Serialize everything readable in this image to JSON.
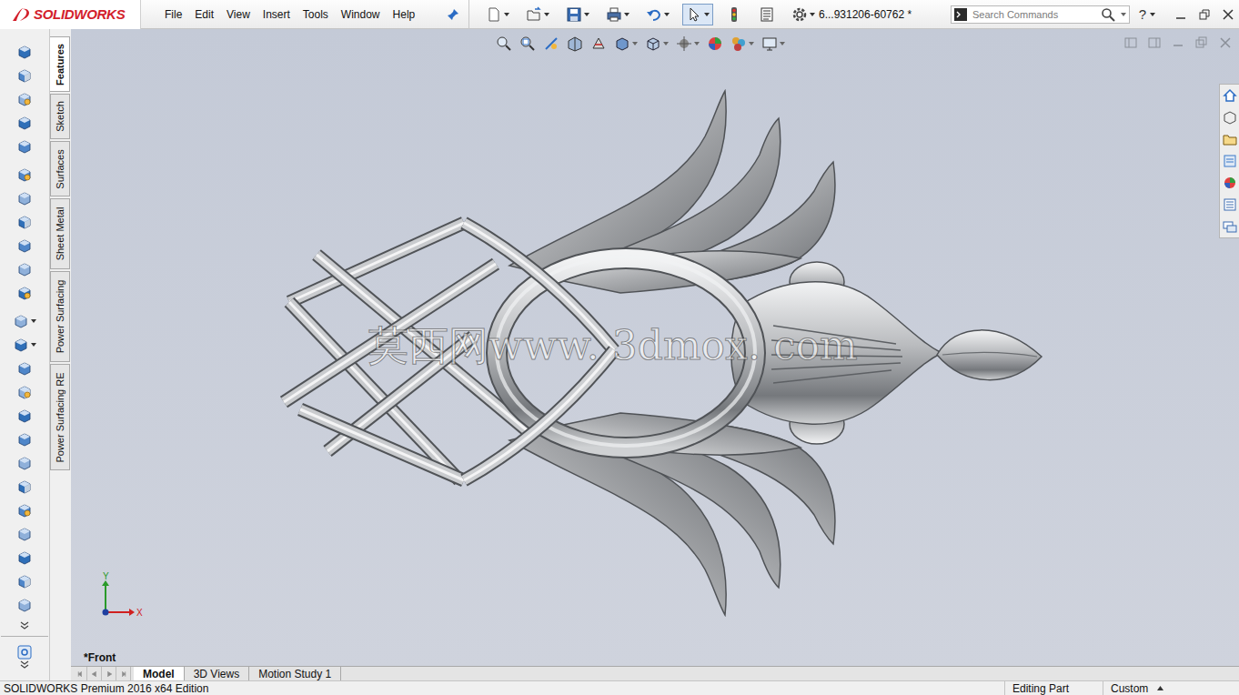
{
  "app": {
    "logo": "SOLIDWORKS",
    "document_title": "6...931206-60762 *"
  },
  "menu": [
    "File",
    "Edit",
    "View",
    "Insert",
    "Tools",
    "Window",
    "Help"
  ],
  "search": {
    "placeholder": "Search Commands"
  },
  "help": "?",
  "command_tabs": [
    {
      "label": "Features",
      "selected": true
    },
    {
      "label": "Sketch",
      "selected": false
    },
    {
      "label": "Surfaces",
      "selected": false
    },
    {
      "label": "Sheet Metal",
      "selected": false
    },
    {
      "label": "Power Surfacing",
      "selected": false
    },
    {
      "label": "Power Surfacing RE",
      "selected": false
    }
  ],
  "viewport": {
    "watermark": "莫西网www. 3dmox. com",
    "view_label": "*Front",
    "axes": [
      {
        "label": "Y",
        "color": "#2a9a2a"
      },
      {
        "label": "X",
        "color": "#d02020"
      }
    ]
  },
  "bottom_tabs": [
    {
      "label": "Model",
      "selected": true
    },
    {
      "label": "3D Views",
      "selected": false
    },
    {
      "label": "Motion Study 1",
      "selected": false
    }
  ],
  "status_bar": {
    "product": "SOLIDWORKS Premium 2016 x64 Edition",
    "mode": "Editing Part",
    "units": "Custom"
  }
}
